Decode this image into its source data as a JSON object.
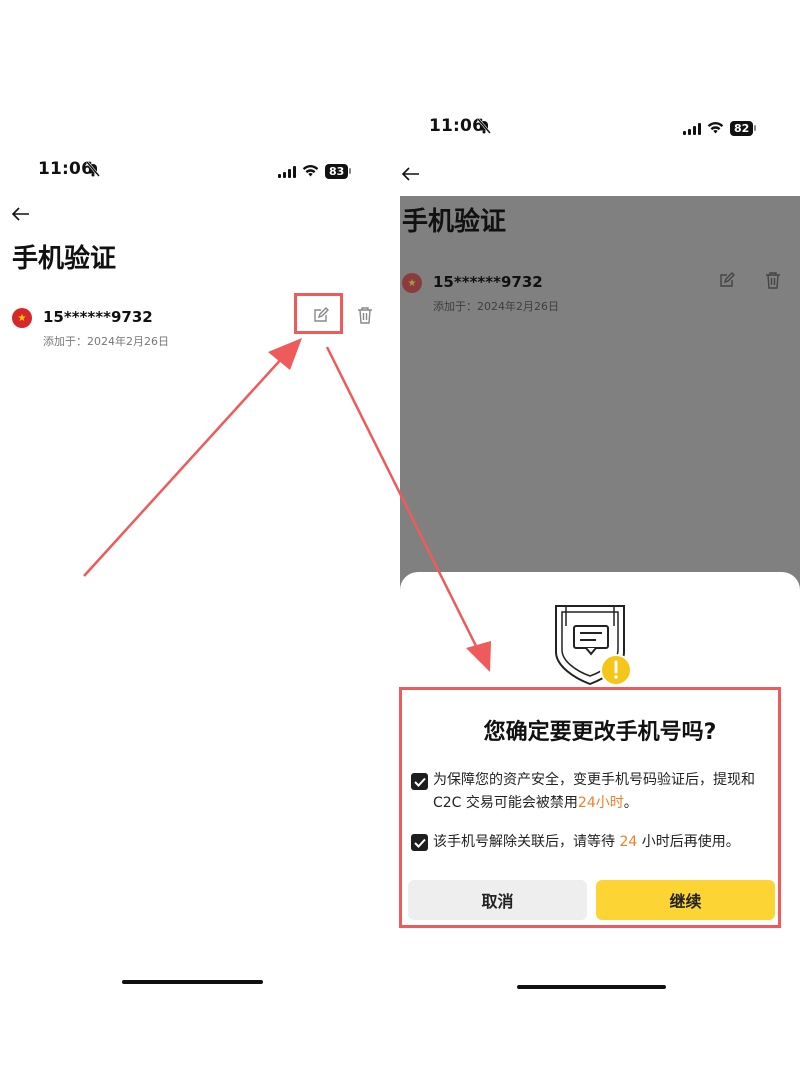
{
  "left_screen": {
    "status": {
      "time": "11:06",
      "battery": "83"
    },
    "page_title": "手机验证",
    "phone_entry": {
      "number": "15******9732",
      "added_label": "添加于：2024年2月26日"
    }
  },
  "right_screen": {
    "status": {
      "time": "11:06",
      "battery": "82"
    },
    "page_title": "手机验证",
    "phone_entry": {
      "number": "15******9732",
      "added_label": "添加于：2024年2月26日"
    },
    "dialog": {
      "title": "您确定要更改手机号吗?",
      "condition1": {
        "line1": "为保障您的资产安全，变更手机号码验证后，提现和",
        "line2_prefix": "C2C 交易可能会被禁用",
        "line2_highlight": "24小时",
        "line2_suffix": "。",
        "checked": true
      },
      "condition2": {
        "prefix": "该手机号解除关联后，请等待 ",
        "highlight": "24",
        "suffix": " 小时后再使用。",
        "checked": true
      },
      "cancel_label": "取消",
      "continue_label": "继续"
    }
  },
  "colors": {
    "accent": "#fcd535",
    "highlight": "#f0802a",
    "annotation": "#ef5a5a",
    "overlay": "#808080"
  }
}
